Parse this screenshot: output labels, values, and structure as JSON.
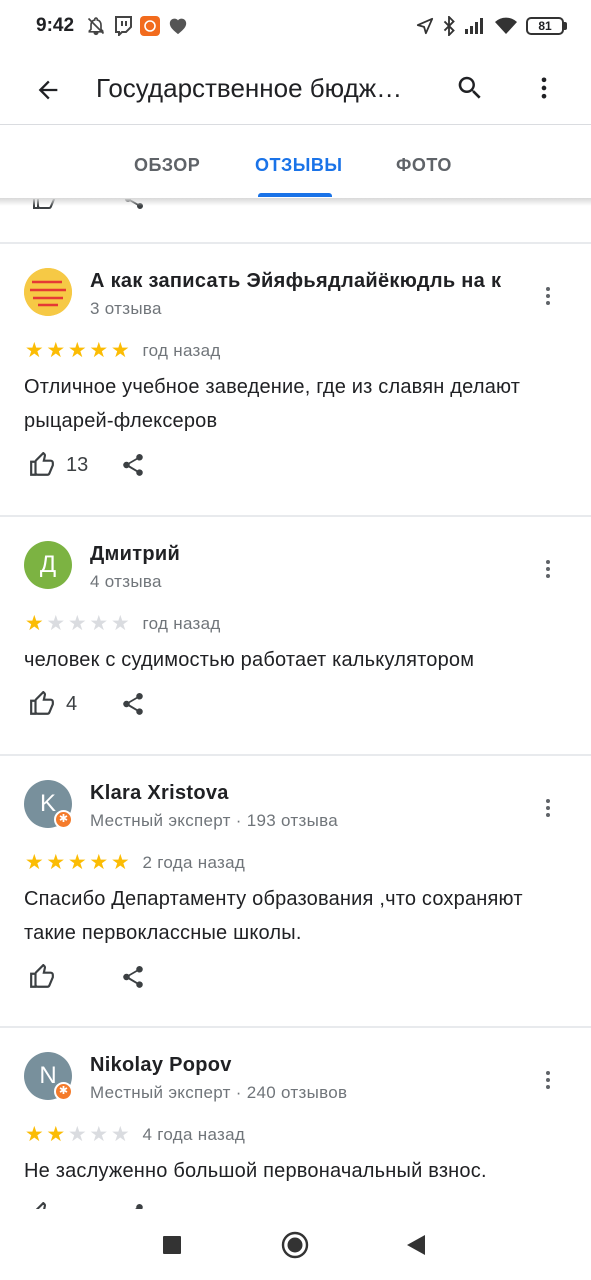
{
  "status_bar": {
    "time": "9:42",
    "battery": "81"
  },
  "app_bar": {
    "title": "Государственное бюдж…"
  },
  "tabs": [
    {
      "label": "ОБЗОР"
    },
    {
      "label": "ОТЗЫВЫ"
    },
    {
      "label": "ФОТО"
    }
  ],
  "active_tab": "ОТЗЫВЫ",
  "reviews": [
    {
      "name": "А как записать Эйяфьядлайёкюдль на к",
      "meta": "3 отзыва",
      "rating": 5,
      "date": "год назад",
      "text": "Отличное учебное заведение, где из славян делают рыцарей-флексеров",
      "likes": "13",
      "avatar_text": "",
      "avatar_color": "#f7c846",
      "local_guide": false
    },
    {
      "name": "Дмитрий",
      "meta": "4 отзыва",
      "rating": 1,
      "date": "год назад",
      "text": "человек с судимостью работает калькулятором",
      "likes": "4",
      "avatar_text": "Д",
      "avatar_color": "#7cb342",
      "local_guide": false
    },
    {
      "name": "Klara Xristova",
      "meta": "Местный эксперт · 193 отзыва",
      "rating": 5,
      "date": "2 года назад",
      "text": "Спасибо Департаменту образования ,что сохраняют такие первоклассные школы.",
      "likes": "",
      "avatar_text": "K",
      "avatar_color": "#78909c",
      "local_guide": true
    },
    {
      "name": "Nikolay Popov",
      "meta": "Местный эксперт · 240 отзывов",
      "rating": 2,
      "date": "4 года назад",
      "text": "Не заслуженно большой первоначальный взнос.",
      "likes": "",
      "avatar_text": "N",
      "avatar_color": "#78909c",
      "local_guide": true
    }
  ],
  "colors": {
    "accent": "#1a73e8",
    "star": "#fbbc04",
    "star_empty": "#dadce0",
    "guide_badge": "#f47b2b"
  },
  "icons": {
    "back": "arrow-back-icon",
    "search": "search-icon",
    "more": "more-vert-icon",
    "like": "thumb-up-icon",
    "share": "share-icon",
    "nav": [
      "stop-square-icon",
      "home-circle-icon",
      "back-triangle-icon"
    ]
  }
}
